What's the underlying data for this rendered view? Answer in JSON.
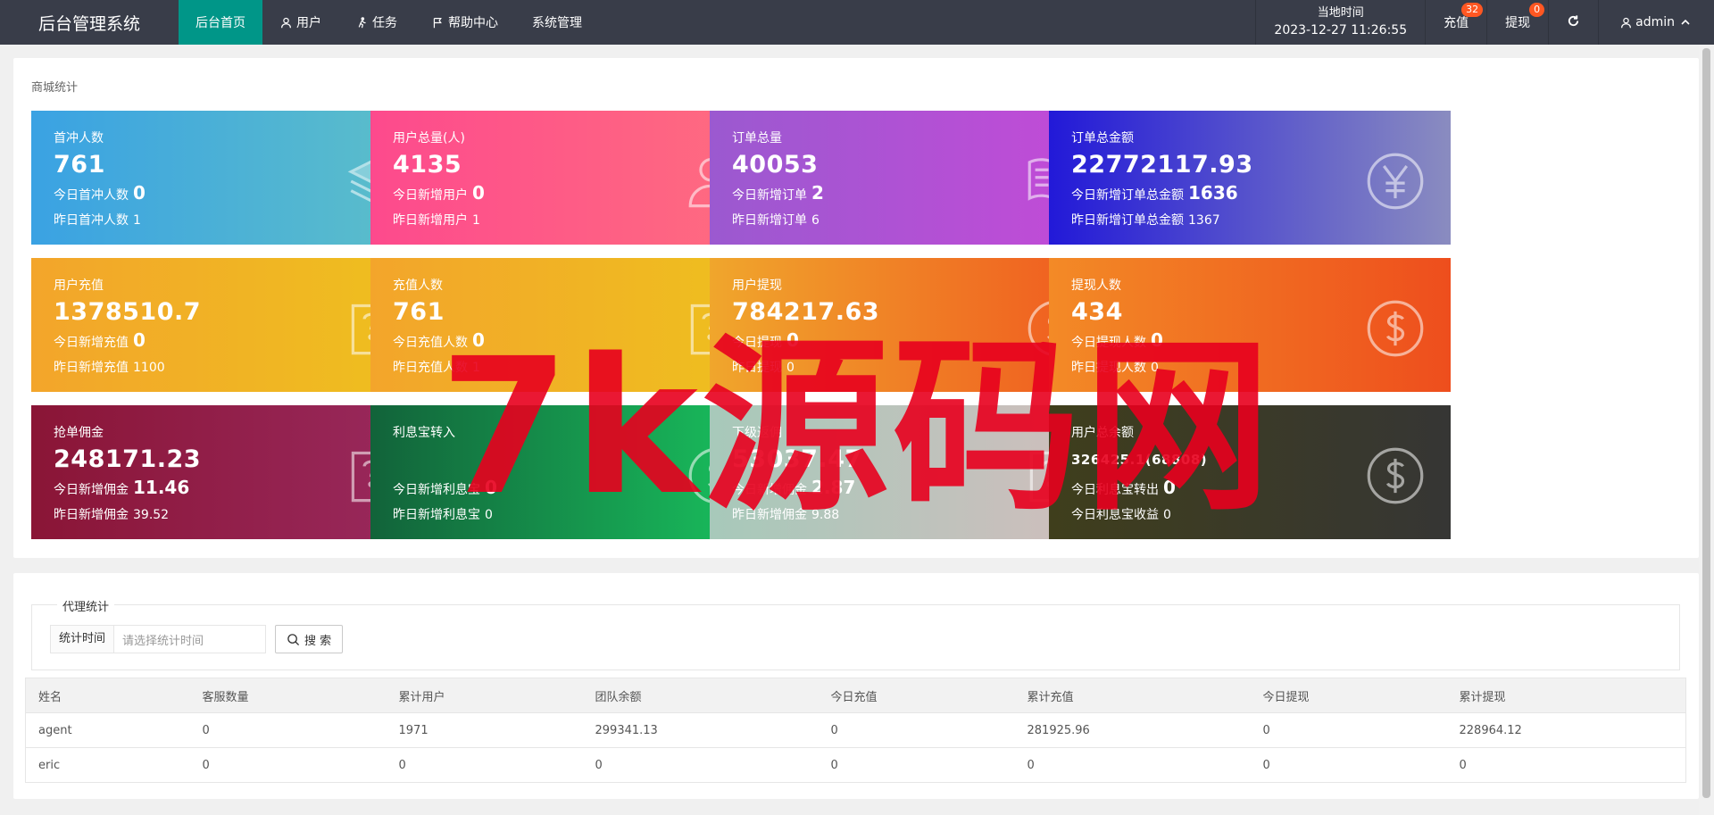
{
  "app": {
    "title": "后台管理系统"
  },
  "nav": [
    {
      "label": "后台首页",
      "icon": "none",
      "active": true
    },
    {
      "label": "用户",
      "icon": "user-icon",
      "active": false
    },
    {
      "label": "任务",
      "icon": "walk-icon",
      "active": false
    },
    {
      "label": "帮助中心",
      "icon": "flag-icon",
      "active": false
    },
    {
      "label": "系统管理",
      "icon": "none",
      "active": false
    }
  ],
  "topright": {
    "clock_label": "当地时间",
    "clock_time": "2023-12-27 11:26:55",
    "recharge_label": "充值",
    "recharge_badge": "32",
    "withdraw_label": "提现",
    "withdraw_badge": "0",
    "refresh_icon": "refresh-icon",
    "user_name": "admin"
  },
  "stats": {
    "title": "商城统计",
    "cards": [
      {
        "title": "首冲人数",
        "value": "761",
        "today_label": "今日首冲人数",
        "today_value": "0",
        "yest_label": "昨日首冲人数",
        "yest_value": "1",
        "icon": "layers-icon",
        "gradient": "linear-gradient(90deg,#3aa2e3,#5ec0c8)"
      },
      {
        "title": "用户总量(人)",
        "value": "4135",
        "today_label": "今日新增用户",
        "today_value": "0",
        "yest_label": "昨日新增用户",
        "yest_value": "1",
        "icon": "users-icon",
        "gradient": "linear-gradient(90deg,#fd4a8d,#ff6e7f)"
      },
      {
        "title": "订单总量",
        "value": "40053",
        "today_label": "今日新增订单",
        "today_value": "2",
        "yest_label": "昨日新增订单",
        "yest_value": "6",
        "icon": "book-icon",
        "gradient": "linear-gradient(90deg,#9b59d0,#c54ad8)"
      },
      {
        "title": "订单总金额",
        "value": "22772117.93",
        "today_label": "今日新增订单总金额",
        "today_value": "1636",
        "yest_label": "昨日新增订单总金额",
        "yest_value": "1367",
        "icon": "yen-icon",
        "gradient": "linear-gradient(90deg,#2219d8,#8a8cc0)"
      },
      {
        "title": "用户充值",
        "value": "1378510.7",
        "today_label": "今日新增充值",
        "today_value": "0",
        "yest_label": "昨日新增充值",
        "yest_value": "1100",
        "icon": "edit-question-icon",
        "gradient": "linear-gradient(90deg,#f3a52b,#eec11e)"
      },
      {
        "title": "充值人数",
        "value": "761",
        "today_label": "今日充值人数",
        "today_value": "0",
        "yest_label": "昨日充值人数",
        "yest_value": "1",
        "icon": "edit-question-icon",
        "gradient": "linear-gradient(90deg,#f3a52b,#eec11e)"
      },
      {
        "title": "用户提现",
        "value": "784217.63",
        "today_label": "今日提现",
        "today_value": "0",
        "yest_label": "昨日提现",
        "yest_value": "0",
        "icon": "dollar-icon",
        "gradient": "linear-gradient(90deg,#f0a62c,#f0571f)"
      },
      {
        "title": "提现人数",
        "value": "434",
        "today_label": "今日提现人数",
        "today_value": "0",
        "yest_label": "昨日提现人数",
        "yest_value": "0",
        "icon": "dollar-icon",
        "gradient": "linear-gradient(90deg,#f38a26,#ee4e1d)"
      },
      {
        "title": "抢单佣金",
        "value": "248171.23",
        "today_label": "今日新增佣金",
        "today_value": "11.46",
        "yest_label": "昨日新增佣金",
        "yest_value": "39.52",
        "icon": "edit-question-icon",
        "gradient": "linear-gradient(90deg,#8a1536,#9a2a5f)"
      },
      {
        "title": "利息宝转入",
        "value": "",
        "today_label": "今日新增利息宝",
        "today_value": "0",
        "yest_label": "昨日新增利息宝",
        "yest_value": "0",
        "icon": "dollar-icon",
        "gradient": "linear-gradient(90deg,#12633a,#19c45f)"
      },
      {
        "title": "下级返佣",
        "value": "53037.47",
        "today_label": "今日新增佣金",
        "today_value": "2.87",
        "yest_label": "昨日新增佣金",
        "yest_value": "9.88",
        "icon": "edit-question-icon",
        "gradient": "linear-gradient(90deg,#a7c9ba,#d2bdbd)"
      },
      {
        "title": "用户总余额",
        "value": "326425.1(68808)",
        "value_small": true,
        "today_label": "今日利息宝转出",
        "today_value": "0",
        "yest_label": "今日利息宝收益",
        "yest_value": "0",
        "icon": "dollar-icon",
        "gradient": "linear-gradient(90deg,#3f3e1c,#363634)"
      }
    ]
  },
  "agent": {
    "legend": "代理统计",
    "filter_label": "统计时间",
    "filter_placeholder": "请选择统计时间",
    "search_label": "搜 索",
    "columns": [
      "姓名",
      "客服数量",
      "累计用户",
      "团队余额",
      "今日充值",
      "累计充值",
      "今日提现",
      "累计提现"
    ],
    "rows": [
      [
        "agent",
        "0",
        "1971",
        "299341.13",
        "0",
        "281925.96",
        "0",
        "228964.12"
      ],
      [
        "eric",
        "0",
        "0",
        "0",
        "0",
        "0",
        "0",
        "0"
      ]
    ]
  },
  "watermark": "7k源码网"
}
